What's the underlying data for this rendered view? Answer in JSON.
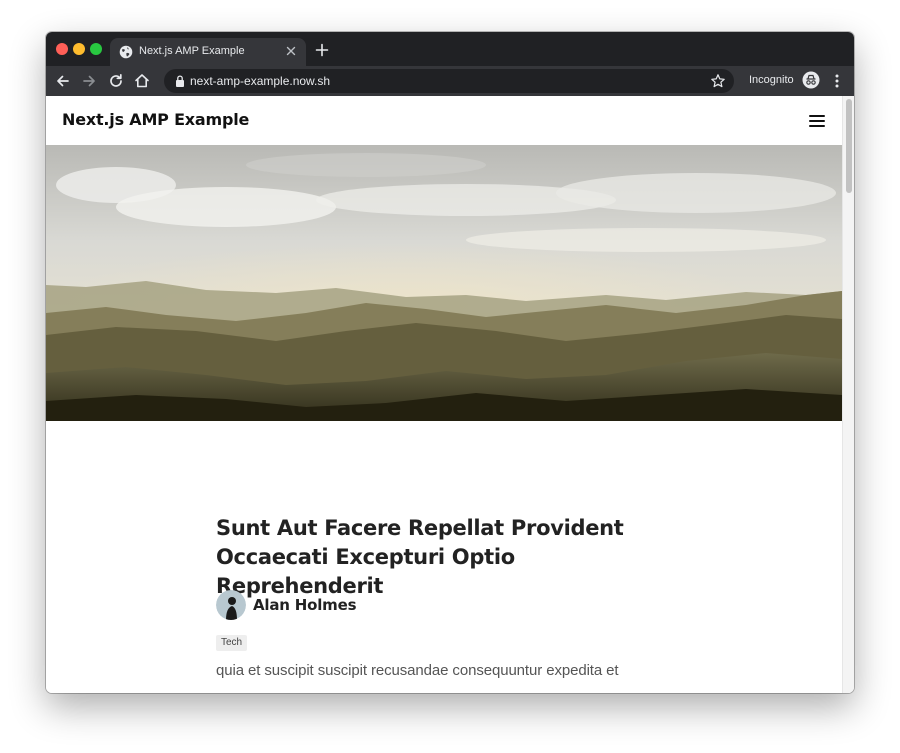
{
  "browser": {
    "tab": {
      "title": "Next.js AMP Example",
      "favicon": "globe-icon"
    },
    "address_bar": {
      "url": "next-amp-example.now.sh",
      "secure_icon": "lock-icon"
    },
    "incognito_label": "Incognito",
    "colors": {
      "tabstrip": "#202124",
      "toolbar": "#35363a",
      "text": "#e8eaed"
    }
  },
  "site": {
    "title": "Next.js AMP Example",
    "menu_icon": "hamburger-icon"
  },
  "post": {
    "title": "Sunt Aut Facere Repellat Provident Occaecati Excepturi Optio Reprehenderit",
    "author": {
      "name": "Alan Holmes",
      "avatar_icon": "avatar"
    },
    "tag": "Tech",
    "excerpt": "quia et suscipit suscipit recusandae consequuntur expedita et"
  }
}
